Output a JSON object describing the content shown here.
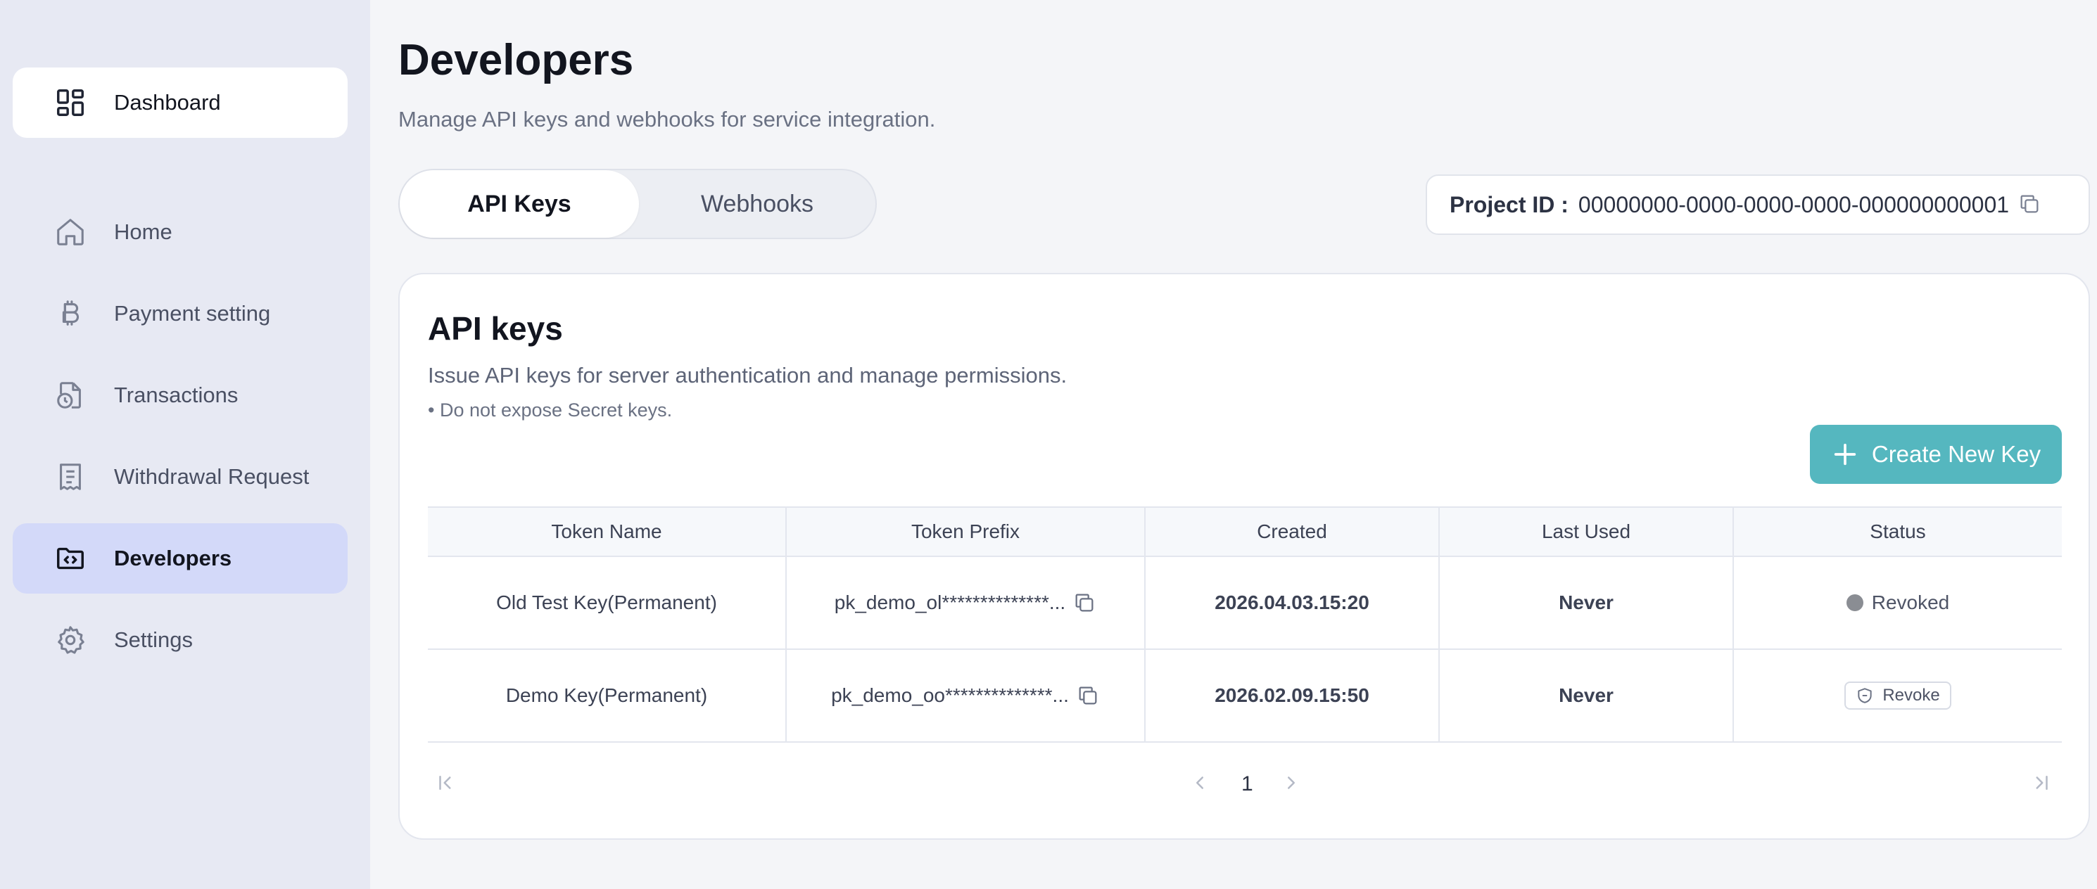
{
  "sidebar": {
    "dashboard": {
      "label": "Dashboard",
      "icon": "dashboard-grid-icon"
    },
    "items": [
      {
        "label": "Home",
        "icon": "home-icon"
      },
      {
        "label": "Payment setting",
        "icon": "bitcoin-icon"
      },
      {
        "label": "Transactions",
        "icon": "document-clock-icon"
      },
      {
        "label": "Withdrawal Request",
        "icon": "receipt-icon"
      },
      {
        "label": "Developers",
        "icon": "folder-code-icon",
        "active": true
      },
      {
        "label": "Settings",
        "icon": "gear-icon"
      }
    ]
  },
  "header": {
    "title": "Developers",
    "subtitle": "Manage API keys and webhooks for service integration."
  },
  "tabs": [
    {
      "label": "API Keys",
      "active": true
    },
    {
      "label": "Webhooks",
      "active": false
    }
  ],
  "project": {
    "label": "Project ID :",
    "value": "00000000-0000-0000-0000-000000000001"
  },
  "card": {
    "title": "API keys",
    "description": "Issue API keys for server authentication and manage permissions.",
    "note": "• Do not expose Secret keys.",
    "create_button": "Create New Key"
  },
  "table": {
    "columns": [
      "Token Name",
      "Token Prefix",
      "Created",
      "Last Used",
      "Status"
    ],
    "rows": [
      {
        "name": "Old Test Key(Permanent)",
        "prefix": "pk_demo_ol**************...",
        "created": "2026.04.03.15:20",
        "last_used": "Never",
        "status": "Revoked"
      },
      {
        "name": "Demo Key(Permanent)",
        "prefix": "pk_demo_oo**************...",
        "created": "2026.02.09.15:50",
        "last_used": "Never",
        "status": "Revoke"
      }
    ]
  },
  "pagination": {
    "current_page": "1"
  },
  "colors": {
    "accent": "#55b7bf",
    "sidebar_bg": "#e7e9f3",
    "sidebar_active": "#d3d9f9",
    "page_bg": "#f4f5f8"
  }
}
